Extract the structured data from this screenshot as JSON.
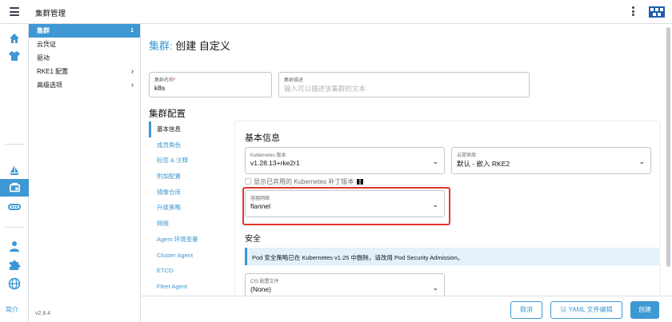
{
  "topbar": {
    "title": "集群管理"
  },
  "nav": {
    "items": [
      {
        "label": "集群",
        "count": "1"
      },
      {
        "label": "云凭证"
      },
      {
        "label": "驱动"
      },
      {
        "label": "RKE1 配置"
      },
      {
        "label": "高级选项"
      }
    ],
    "about": "简介",
    "version": "v2.8.4"
  },
  "page": {
    "title_link": "集群:",
    "title_rest": " 创建 自定义"
  },
  "form": {
    "cluster_name": {
      "label": "集群名称",
      "required": "*",
      "value": "k8s"
    },
    "cluster_desc": {
      "label": "集群描述",
      "placeholder": "输入可以描述该集群的文本"
    }
  },
  "config": {
    "section_title": "集群配置",
    "tabs": [
      "基本信息",
      "成员角色",
      "标签 & 注释",
      "附加配置",
      "镜像仓库",
      "升级策略",
      "网络",
      "Agent 环境变量",
      "Cluster Agent",
      "ETCD",
      "Fleet Agent"
    ],
    "content_title": "基本信息",
    "kubernetes": {
      "label": "Kubernetes 版本",
      "value": "v1.28.13+rke2r1"
    },
    "cloud": {
      "label": "云提供商",
      "value": "默认 - 嵌入 RKE2"
    },
    "show_deprecated": "显示已弃用的 Kubernetes 补丁版本",
    "cni": {
      "label": "容器网络",
      "value": "flannel"
    },
    "security_title": "安全",
    "banner": "Pod 安全策略已在 Kubernetes v1.25 中删除，请改用 Pod Security Admission。",
    "cis": {
      "label": "CIS 配置文件",
      "value": "(None)"
    }
  },
  "footer": {
    "cancel": "取消",
    "yaml": "以 YAML 文件编辑",
    "create": "创建"
  },
  "colors": {
    "accent": "#3d98d3",
    "highlight": "#e0352b"
  }
}
